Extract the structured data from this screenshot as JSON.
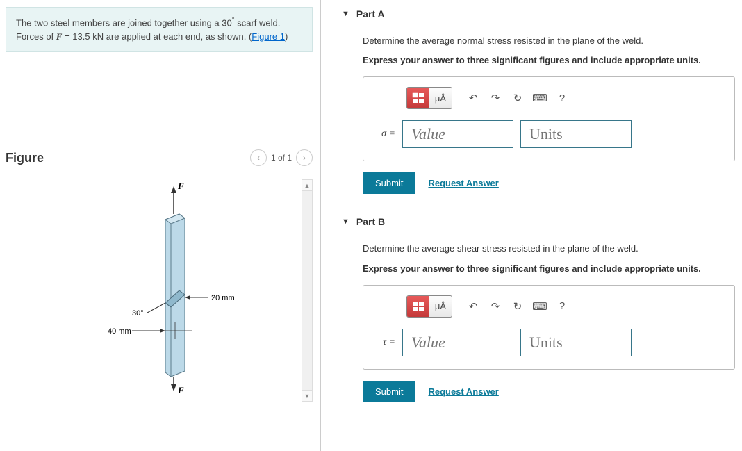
{
  "problem": {
    "text_prefix": "The two steel members are joined together using a 30",
    "degree": "°",
    "text_mid": " scarf weld. Forces of ",
    "force_var": "F",
    "force_eq": " = 13.5 kN",
    "text_suffix": " are applied at each end, as shown. (",
    "figure_link": "Figure 1",
    "text_close": ")"
  },
  "figure": {
    "title": "Figure",
    "counter": "1 of 1",
    "labels": {
      "F_top": "F",
      "F_bot": "F",
      "angle": "30°",
      "width": "20 mm",
      "depth": "40 mm"
    }
  },
  "partA": {
    "title": "Part A",
    "prompt": "Determine the average normal stress resisted in the plane of the weld.",
    "instruction": "Express your answer to three significant figures and include appropriate units.",
    "var": "σ =",
    "value_placeholder": "Value",
    "units_placeholder": "Units",
    "submit": "Submit",
    "request": "Request Answer"
  },
  "partB": {
    "title": "Part B",
    "prompt": "Determine the average shear stress resisted in the plane of the weld.",
    "instruction": "Express your answer to three significant figures and include appropriate units.",
    "var": "τ =",
    "value_placeholder": "Value",
    "units_placeholder": "Units",
    "submit": "Submit",
    "request": "Request Answer"
  },
  "toolbar": {
    "mu_a": "μÅ",
    "undo": "↶",
    "redo": "↷",
    "reset": "↻",
    "keyboard": "⌨",
    "help": "?"
  }
}
